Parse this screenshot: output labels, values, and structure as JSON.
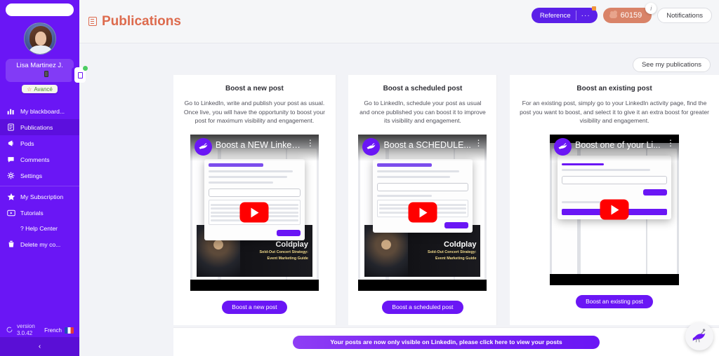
{
  "sidebar": {
    "search_placeholder": "",
    "user": {
      "name": "Lisa  Martinez J.",
      "plan_badge": "Avancé",
      "plan_star": "☆"
    },
    "items": [
      {
        "label": "My blackboard...",
        "icon": "chart-bar-icon",
        "active": false
      },
      {
        "label": "Publications",
        "icon": "document-icon",
        "active": true
      },
      {
        "label": "Pods",
        "icon": "megaphone-icon",
        "active": false
      },
      {
        "label": "Comments",
        "icon": "chat-bubble-icon",
        "active": false
      },
      {
        "label": "Settings",
        "icon": "gear-icon",
        "active": false
      },
      {
        "label": "My Subscription",
        "icon": "star-icon",
        "active": false
      },
      {
        "label": "Tutorials",
        "icon": "video-icon",
        "active": false
      },
      {
        "label": "? Help Center",
        "icon": "question-icon",
        "active": false
      },
      {
        "label": "Delete my co...",
        "icon": "trash-icon",
        "active": false
      }
    ],
    "footer": {
      "version_line1": "version",
      "version_line2": "3.0.42",
      "language": "French"
    },
    "collapse_label": "‹"
  },
  "header": {
    "title": "Publications",
    "title_color": "#dd6b4e",
    "reference_label": "Reference",
    "reference_dots": "···",
    "credits_value": "60159",
    "credits_info": "i",
    "notifications_label": "Notifications",
    "see_publications_label": "See my publications"
  },
  "cards": [
    {
      "title": "Boost a new post",
      "description": "Go to LinkedIn, write and publish your post as usual. Once live, you will have the opportunity to boost your post for maximum visibility and engagement.",
      "video_title": "Boost a NEW Linked...",
      "button_label": "Boost a new post",
      "thumb_overlay_title": "Coldplay",
      "thumb_overlay_sub1": "Sold-Out Concert Strategy:",
      "thumb_overlay_sub2": "Event Marketing Guide"
    },
    {
      "title": "Boost a scheduled post",
      "description": "Go to LinkedIn, schedule your post as usual and once published you can boost it to improve its visibility and engagement.",
      "video_title": "Boost a SCHEDULE...",
      "button_label": "Boost a scheduled post",
      "thumb_overlay_title": "Coldplay",
      "thumb_overlay_sub1": "Sold-Out Concert Strategy:",
      "thumb_overlay_sub2": "Event Marketing Guide"
    },
    {
      "title": "Boost an existing post",
      "description": "For an existing post, simply go to your LinkedIn activity page, find the post you want to boost, and select it to give it an extra boost for greater visibility and engagement.",
      "video_title": "Boost one of your Li...",
      "button_label": "Boost an existing post",
      "thumb_overlay_title": "",
      "thumb_overlay_sub1": "",
      "thumb_overlay_sub2": ""
    }
  ],
  "footer_banner": {
    "label": "Your posts are now only visible on Linkedin, please click here to view your posts"
  },
  "colors": {
    "brand_purple": "#6a16f5",
    "accent_orange": "#dd6b4e",
    "credits_bg": "#d98368",
    "play_red": "#ff0000"
  }
}
